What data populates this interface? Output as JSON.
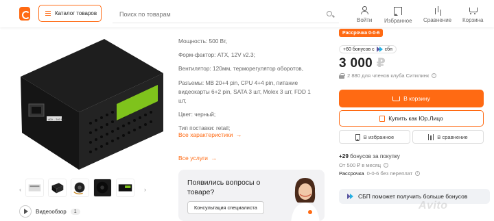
{
  "header": {
    "catalog_label": "Каталог товаров",
    "search_placeholder": "Поиск по товарам",
    "nav": {
      "login": "Войти",
      "favorites": "Избранное",
      "compare": "Сравнение",
      "cart": "Корзина"
    }
  },
  "gallery": {
    "prev": "‹",
    "next": "›",
    "thumbnail_count": 5,
    "psu_label": "400 – 240 Vac",
    "video_label": "Видеообзор",
    "video_count": "1"
  },
  "specs": {
    "power": "Мощность: 500 Вт,",
    "form_factor": "Форм-фактор: ATX, 12V v2.3;",
    "fan": "Вентилятор: 120мм, терморегулятор оборотов,",
    "connectors": "Разъемы: MB 20+4 pin, CPU 4+4 pin, питание видеокарты 6+2 pin, SATA 3 шт, Molex 3 шт, FDD 1 шт,",
    "color": "Цвет: черный;",
    "delivery": "Тип поставки: retail;",
    "all_specs_link": "Все характеристики",
    "all_services_link": "Все услуги"
  },
  "question": {
    "title": "Появились вопросы о товаре?",
    "consult_button": "Консультация специалиста"
  },
  "buy": {
    "promo": "Рассрочка 0-0-6",
    "bonus_badge": "+60 бонусов с",
    "sbp_label": "сбп",
    "price": "3 000",
    "currency": "₽",
    "club_price": "2 880 для членов клуба Ситилинк",
    "cart_button": "В корзину",
    "legal_button": "Купить как Юр.Лицо",
    "favorite_button": "В избранное",
    "compare_button": "В сравнение",
    "bonus_prefix": "+29",
    "bonus_text": "бонусов за покупку",
    "installment": "От 500 ₽ в месяц",
    "installment_plan_prefix": "Рассрочка",
    "installment_plan": "0-0-6 без переплат",
    "sbp_banner": "СБП поможет получить больше бонусов"
  },
  "colors": {
    "accent": "#ff6a13",
    "text": "#222222",
    "muted": "#888888"
  }
}
